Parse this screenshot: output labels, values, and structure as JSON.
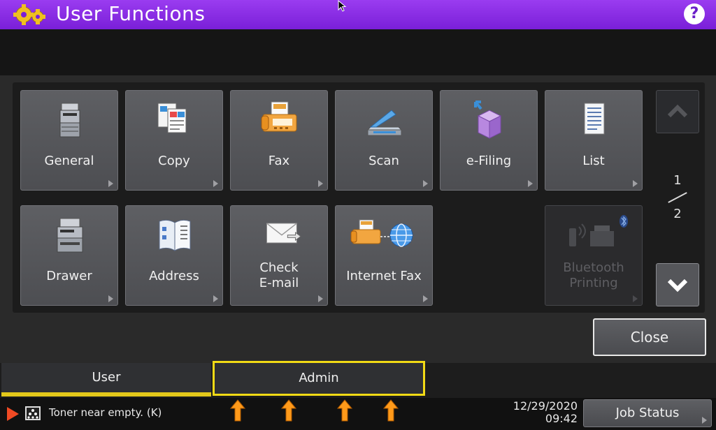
{
  "header": {
    "title": "User Functions",
    "help_label": "?"
  },
  "tiles": [
    {
      "label": "General",
      "icon": "printer-icon"
    },
    {
      "label": "Copy",
      "icon": "copy-documents-icon"
    },
    {
      "label": "Fax",
      "icon": "fax-icon"
    },
    {
      "label": "Scan",
      "icon": "scanner-icon"
    },
    {
      "label": "e-Filing",
      "icon": "e-filing-box-icon"
    },
    {
      "label": "List",
      "icon": "list-document-icon"
    },
    {
      "label": "Drawer",
      "icon": "drawer-printer-icon"
    },
    {
      "label": "Address",
      "icon": "address-book-icon"
    },
    {
      "label": "Check\nE-mail",
      "line1": "Check",
      "line2": "E-mail",
      "icon": "envelope-icon"
    },
    {
      "label": "Internet Fax",
      "icon": "internet-fax-icon"
    },
    {
      "label": "Bluetooth Printing",
      "line1": "Bluetooth",
      "line2": "Printing",
      "icon": "bluetooth-printer-icon",
      "disabled": true
    }
  ],
  "pager": {
    "current": "1",
    "total": "2"
  },
  "close_label": "Close",
  "tabs": {
    "user": "User",
    "admin": "Admin"
  },
  "status": {
    "message": "Toner near empty. (K)",
    "date": "12/29/2020",
    "time": "09:42",
    "job_status_label": "Job Status"
  },
  "colors": {
    "header": "#8a2fe6",
    "tab_highlight": "#f2da15",
    "alert_arrow": "#ff9a1a",
    "warning_play": "#f04a24"
  }
}
